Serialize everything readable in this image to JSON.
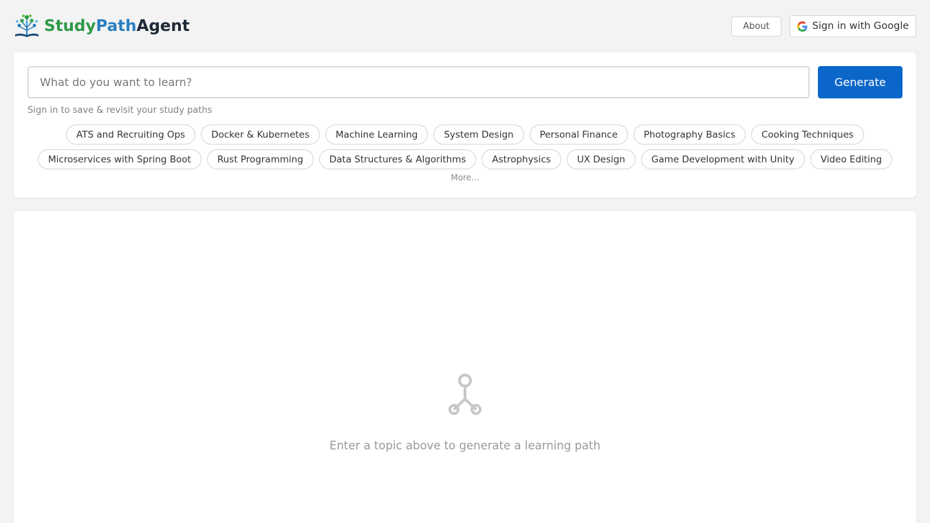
{
  "header": {
    "brand": {
      "part1": "Study",
      "part2": "Path",
      "part3": "Agent"
    },
    "logo_icon": "tree-book-icon",
    "about_label": "About",
    "signin_label": "Sign in with Google",
    "signin_icon": "google-icon"
  },
  "search": {
    "placeholder": "What do you want to learn?",
    "value": "",
    "generate_label": "Generate",
    "hint": "Sign in to save & revisit your study paths",
    "suggestions_row1": [
      "ATS and Recruiting Ops",
      "Docker & Kubernetes",
      "Machine Learning",
      "System Design",
      "Personal Finance",
      "Photography Basics",
      "Cooking Techniques"
    ],
    "suggestions_row2": [
      "Microservices with Spring Boot",
      "Rust Programming",
      "Data Structures & Algorithms",
      "Astrophysics",
      "UX Design",
      "Game Development with Unity",
      "Video Editing"
    ],
    "more_label": "More..."
  },
  "result": {
    "empty_icon": "branch-path-icon",
    "empty_message": "Enter a topic above to generate a learning path"
  },
  "colors": {
    "primary": "#0b66c9",
    "brand_green": "#2e9a47",
    "brand_blue": "#2a7fc0",
    "brand_dark": "#1f2937",
    "background": "#f3f3f3"
  }
}
